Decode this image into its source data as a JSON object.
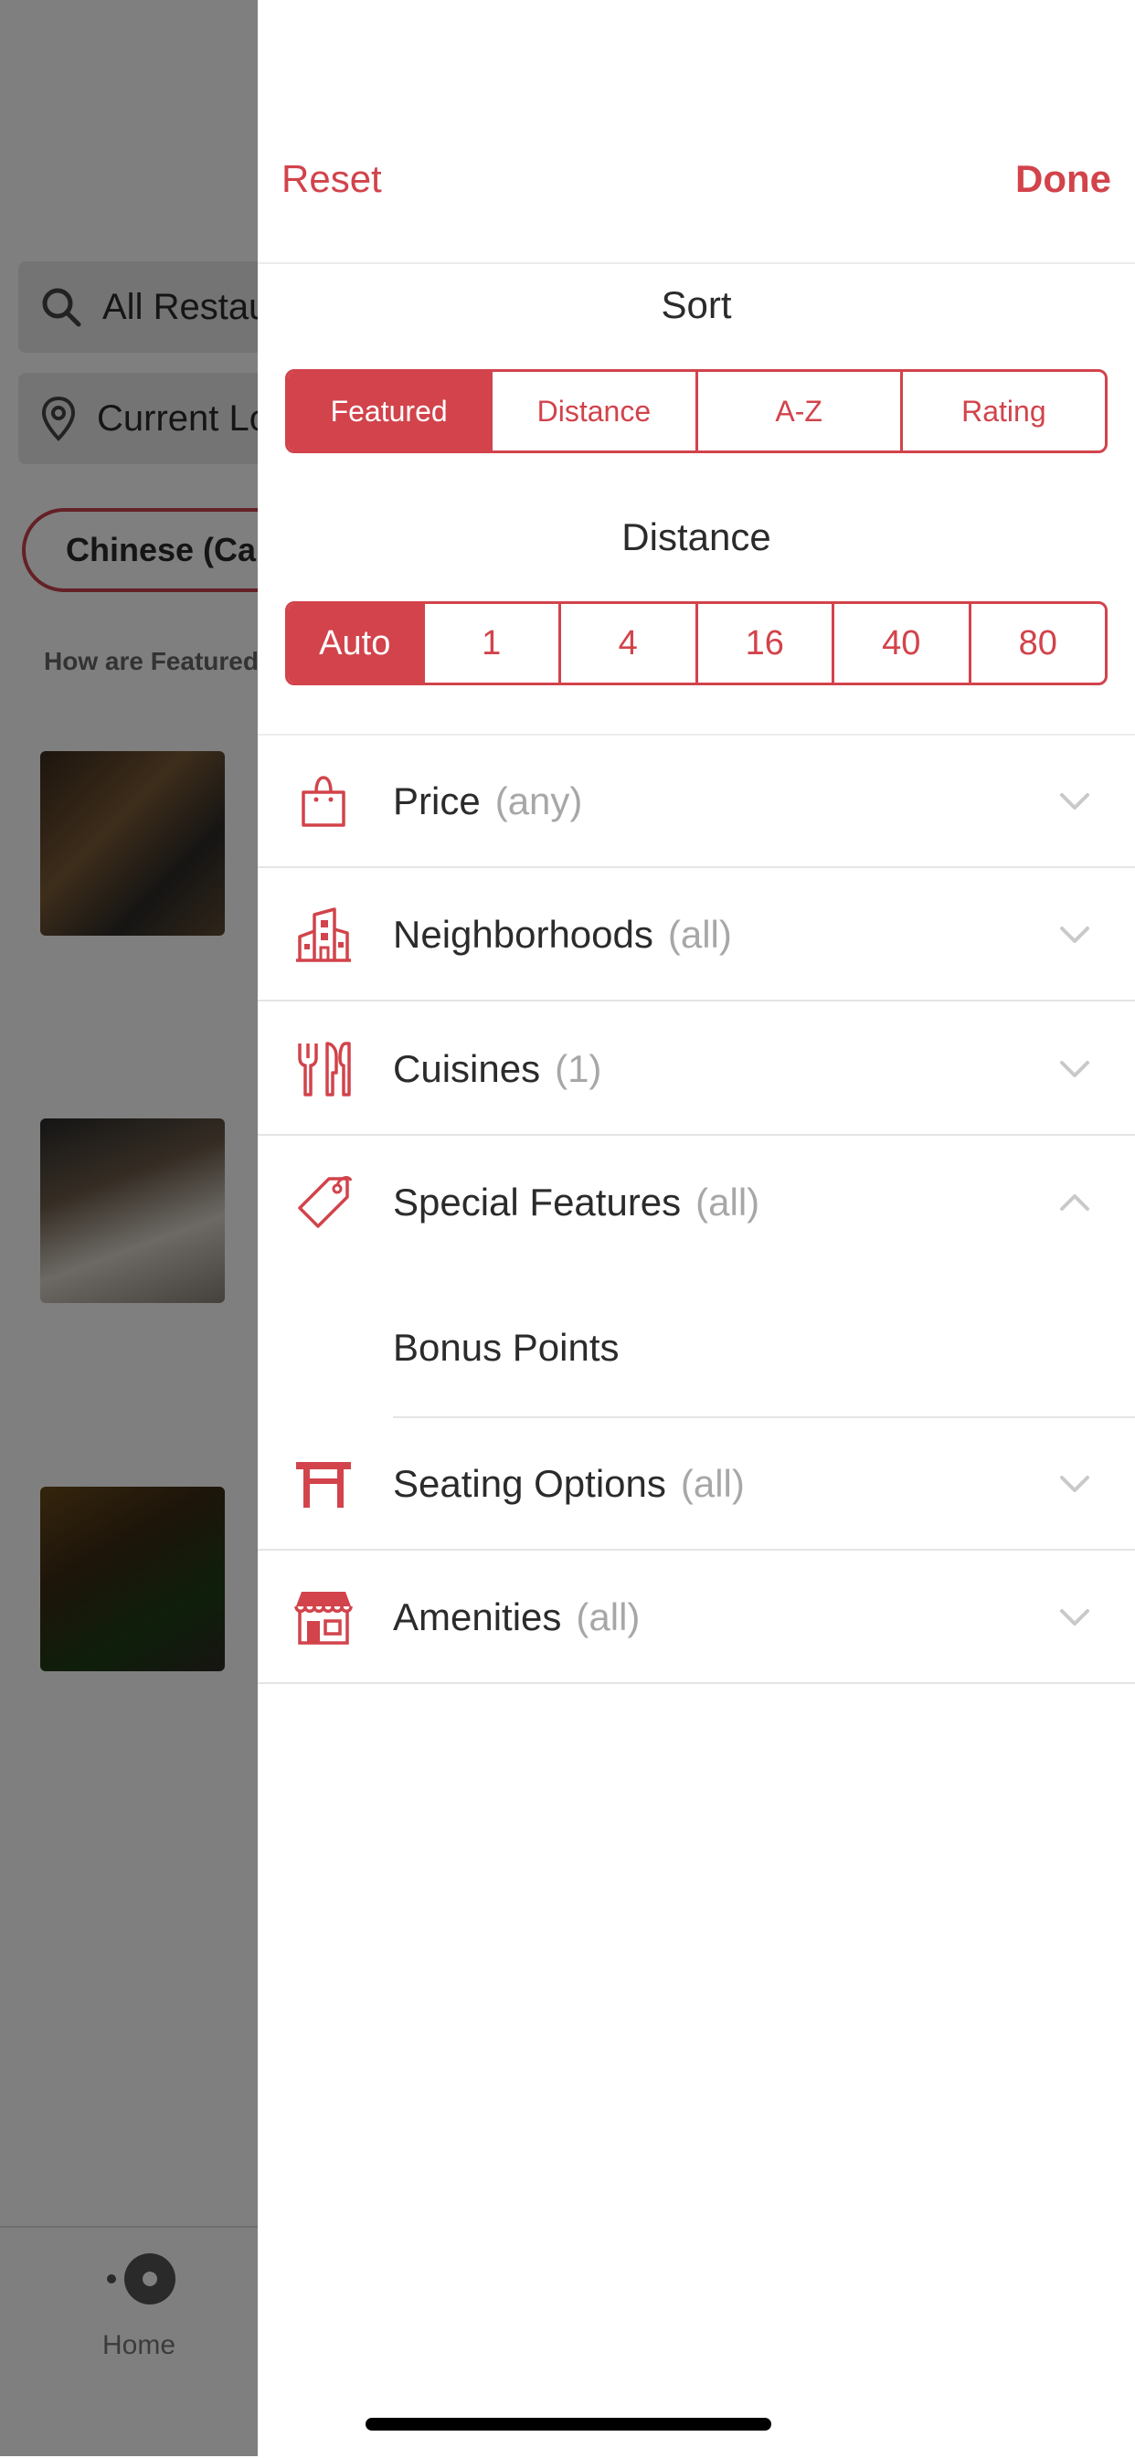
{
  "colors": {
    "accent": "#d2434b",
    "text": "#2b2b2b",
    "muted": "#a7a7a7",
    "overlay": "rgba(0,0,0,0.5)"
  },
  "background": {
    "search_placeholder": "All Restaurants",
    "location_label": "Current Location",
    "cuisine_chip": "Chinese (Cantonese)",
    "how_featured": "How are Featured results sorted?",
    "tab_home": "Home"
  },
  "header": {
    "reset": "Reset",
    "done": "Done"
  },
  "sort": {
    "title": "Sort",
    "options": [
      "Featured",
      "Distance",
      "A-Z",
      "Rating"
    ],
    "selected": "Featured"
  },
  "distance": {
    "title": "Distance",
    "options": [
      "Auto",
      "1",
      "4",
      "16",
      "40",
      "80"
    ],
    "selected": "Auto"
  },
  "filters": [
    {
      "label": "Price",
      "hint": "(any)",
      "icon": "shopping-bag-icon",
      "expanded": false
    },
    {
      "label": "Neighborhoods",
      "hint": "(all)",
      "icon": "buildings-icon",
      "expanded": false
    },
    {
      "label": "Cuisines",
      "hint": "(1)",
      "icon": "utensils-icon",
      "expanded": false
    },
    {
      "label": "Special Features",
      "hint": "(all)",
      "icon": "tag-icon",
      "expanded": true,
      "items": [
        "Bonus Points"
      ]
    },
    {
      "label": "Seating Options",
      "hint": "(all)",
      "icon": "table-icon",
      "expanded": false
    },
    {
      "label": "Amenities",
      "hint": "(all)",
      "icon": "storefront-icon",
      "expanded": false
    }
  ]
}
